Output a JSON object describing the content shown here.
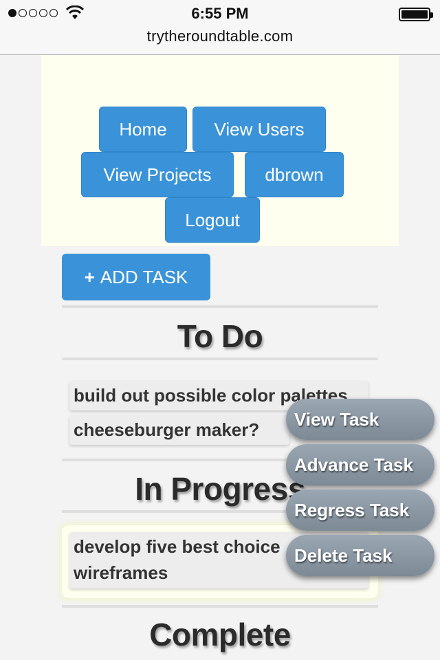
{
  "status_bar": {
    "time": "6:55 PM",
    "url": "trytheroundtable.com",
    "signal_icon": "signal-dots-icon",
    "wifi_icon": "wifi-icon",
    "battery_icon": "battery-icon"
  },
  "nav": {
    "home": "Home",
    "view_users": "View Users",
    "view_projects": "View Projects",
    "user": "dbrown",
    "logout": "Logout"
  },
  "add_task": {
    "plus": "+",
    "label": "ADD TASK"
  },
  "sections": {
    "todo": "To Do",
    "in_progress": "In Progress",
    "complete": "Complete"
  },
  "tasks": {
    "todo": [
      "build out possible color palettes",
      "cheeseburger maker?"
    ],
    "in_progress": [
      "develop five best choice",
      "wireframes"
    ]
  },
  "context_menu": {
    "view": "View Task",
    "advance": "Advance Task",
    "regress": "Regress Task",
    "delete": "Delete Task"
  },
  "colors": {
    "button_blue": "#3a93d8",
    "header_bg": "#fffff0",
    "logo_blue": "#4a6fc6",
    "menu_gray": "#8a96a2"
  }
}
